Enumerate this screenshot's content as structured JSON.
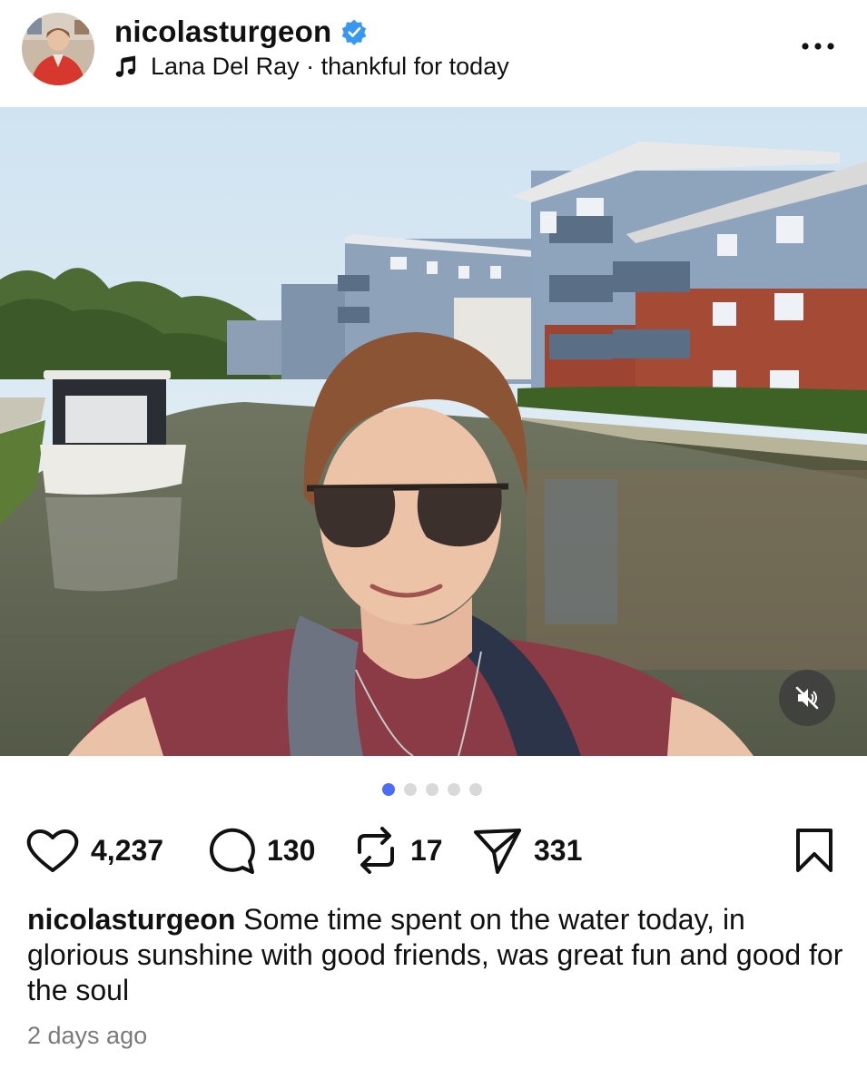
{
  "header": {
    "username": "nicolasturgeon",
    "verified": true,
    "music_label": "Lana Del Ray · thankful for today",
    "more_icon": "more-horizontal-icon"
  },
  "post": {
    "media_icon_muted": "speaker-muted-icon",
    "carousel": {
      "total": 5,
      "current": 1
    },
    "actions": {
      "likes": "4,237",
      "comments": "130",
      "reposts": "17",
      "shares": "331"
    },
    "caption": {
      "username": "nicolasturgeon",
      "text": "Some time spent on the water today, in glorious sunshine with good friends, was great fun and good for the soul"
    },
    "timestamp": "2 days ago"
  },
  "colors": {
    "verified_blue": "#3897f0",
    "active_dot": "#4a6cf7",
    "inactive_dot": "#d9d9d9",
    "timestamp_gray": "#7a7a7a"
  }
}
